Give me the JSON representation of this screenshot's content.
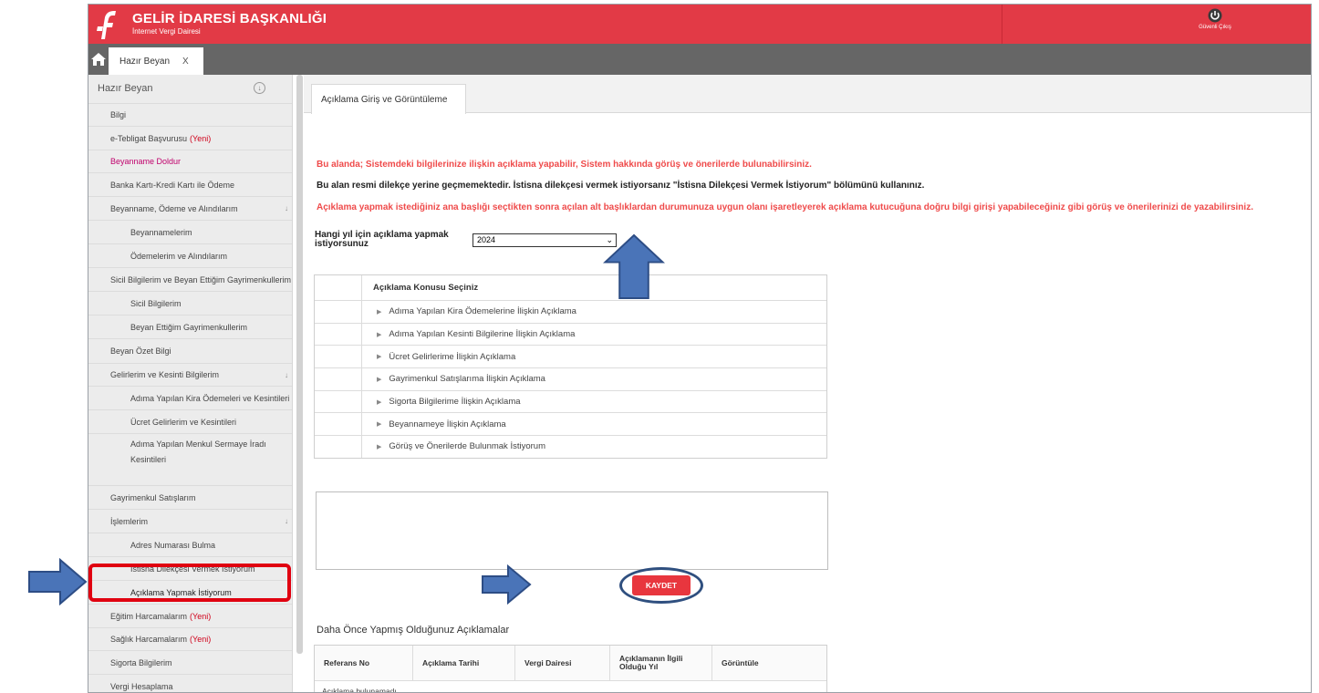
{
  "header": {
    "title": "GELİR İDARESİ BAŞKANLIĞI",
    "subtitle": "İnternet Vergi Dairesi",
    "logout_label": "Güvenli Çıkış",
    "colors": {
      "header_bg": "#e23a46",
      "tabbar_bg": "#666666"
    }
  },
  "topbar": {
    "home_icon": "home-icon",
    "tab_label": "Hazır Beyan",
    "tab_close": "X"
  },
  "sidebar": {
    "title": "Hazır Beyan",
    "items": [
      {
        "label": "Bilgi"
      },
      {
        "label": "e-Tebligat Başvurusu",
        "badge": "(Yeni)"
      },
      {
        "label": "Beyanname Doldur"
      },
      {
        "label": "Banka Kartı-Kredi Kartı ile Ödeme"
      },
      {
        "label": "Beyanname, Ödeme ve Alındılarım"
      },
      {
        "label": "Beyannamelerim"
      },
      {
        "label": "Ödemelerim ve Alındılarım"
      },
      {
        "label": "Sicil Bilgilerim ve Beyan Ettiğim Gayrimenkullerim"
      },
      {
        "label": "Sicil Bilgilerim"
      },
      {
        "label": "Beyan Ettiğim Gayrimenkullerim"
      },
      {
        "label": "Beyan Özet Bilgi"
      },
      {
        "label": "Gelirlerim ve Kesinti Bilgilerim"
      },
      {
        "label": "Adıma Yapılan Kira Ödemeleri ve Kesintileri"
      },
      {
        "label": "Ücret Gelirlerim ve Kesintileri"
      },
      {
        "label": "Adıma Yapılan Menkul Sermaye İradı Kesintileri"
      },
      {
        "label": "Gayrimenkul Satışlarım"
      },
      {
        "label": "İşlemlerim"
      },
      {
        "label": "Adres Numarası Bulma"
      },
      {
        "label": "İstisna Dilekçesi Vermek İstiyorum"
      },
      {
        "label": "Açıklama Yapmak İstiyorum"
      },
      {
        "label": "Eğitim Harcamalarım",
        "badge": "(Yeni)"
      },
      {
        "label": "Sağlık Harcamalarım",
        "badge": "(Yeni)"
      },
      {
        "label": "Sigorta Bilgilerim"
      },
      {
        "label": "Vergi Hesaplama"
      }
    ]
  },
  "main": {
    "tab_label": "Açıklama Giriş ve Görüntüleme",
    "messages": {
      "line1": "Bu alanda; Sistemdeki bilgilerinize ilişkin açıklama yapabilir, Sistem hakkında görüş ve önerilerde bulunabilirsiniz.",
      "line2": "Bu alan resmi dilekçe yerine geçmemektedir. İstisna dilekçesi vermek istiyorsanız \"İstisna Dilekçesi Vermek İstiyorum\" bölümünü kullanınız.",
      "line3": "Açıklama yapmak istediğiniz ana başlığı seçtikten sonra açılan alt başlıklardan durumunuza uygun olanı işaretleyerek açıklama kutucuğuna doğru bilgi girişi yapabileceğiniz gibi görüş ve önerilerinizi de yazabilirsiniz."
    },
    "year_label": "Hangi yıl için açıklama yapmak istiyorsunuz",
    "year_value": "2024",
    "topic_header": "Açıklama Konusu Seçiniz",
    "topics": [
      "Adıma Yapılan Kira Ödemelerine İlişkin Açıklama",
      "Adıma Yapılan Kesinti Bilgilerine İlişkin Açıklama",
      "Ücret Gelirlerime İlişkin Açıklama",
      "Gayrimenkul Satışlarıma İlişkin Açıklama",
      "Sigorta Bilgilerime İlişkin Açıklama",
      "Beyannameye İlişkin Açıklama",
      "Görüş ve Önerilerde Bulunmak İstiyorum"
    ],
    "comment_value": "",
    "save_label": "KAYDET",
    "previous_title": "Daha Önce Yapmış Olduğunuz Açıklamalar",
    "previous_columns": [
      "Referans No",
      "Açıklama Tarihi",
      "Vergi Dairesi",
      "Açıklamanın İlgili Olduğu Yıl",
      "Görüntüle"
    ],
    "previous_empty": "Açıklama bulunamadı."
  },
  "annotations": {
    "arrow_color": "#3c6ab0",
    "highlight_color": "#e00010"
  }
}
